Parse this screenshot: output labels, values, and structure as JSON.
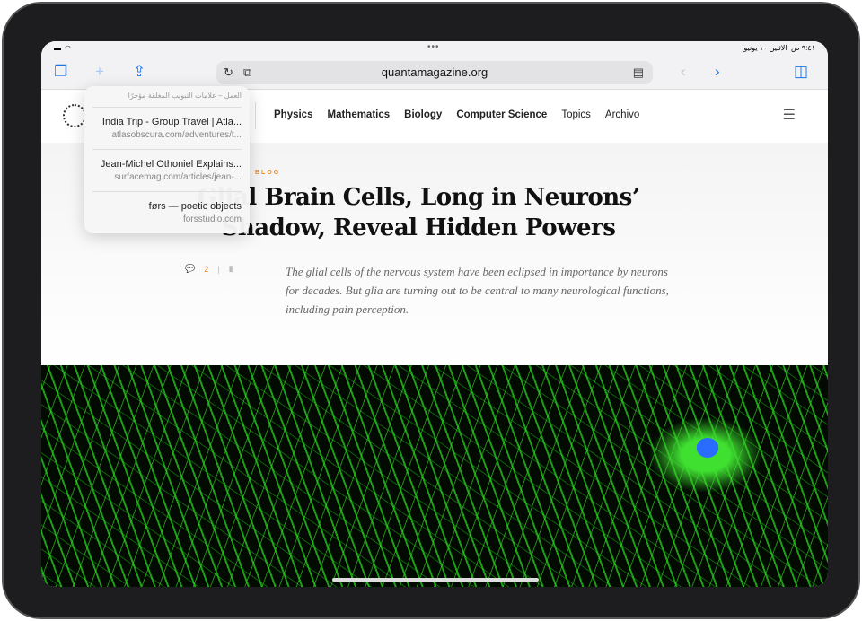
{
  "status": {
    "time": "٩:٤١ ص",
    "date": "الاثنين ١٠ يونيو"
  },
  "toolbar": {
    "url": "quantamagazine.org"
  },
  "site": {
    "nav": [
      "Physics",
      "Mathematics",
      "Biology",
      "Computer Science",
      "Topics",
      "Archivo"
    ]
  },
  "article": {
    "kicker": "BLOG",
    "title": "Glial Brain Cells, Long in Neurons’ Shadow, Reveal Hidden Powers",
    "comments": "2",
    "dek": "The glial cells of the nervous system have been eclipsed in importance by neurons for decades. But glia are turning out to be central to many neurological functions, including pain perception."
  },
  "popup": {
    "header": "العمل – علامات التبويب المغلقة مؤخرًا",
    "items": [
      {
        "title": "India Trip - Group Travel | Atla...",
        "url": "atlasobscura.com/adventures/t..."
      },
      {
        "title": "Jean-Michel Othoniel Explains...",
        "url": "surfacemag.com/articles/jean-..."
      },
      {
        "title": "førs — poetic objects",
        "url": "forsstudio.com"
      }
    ]
  }
}
